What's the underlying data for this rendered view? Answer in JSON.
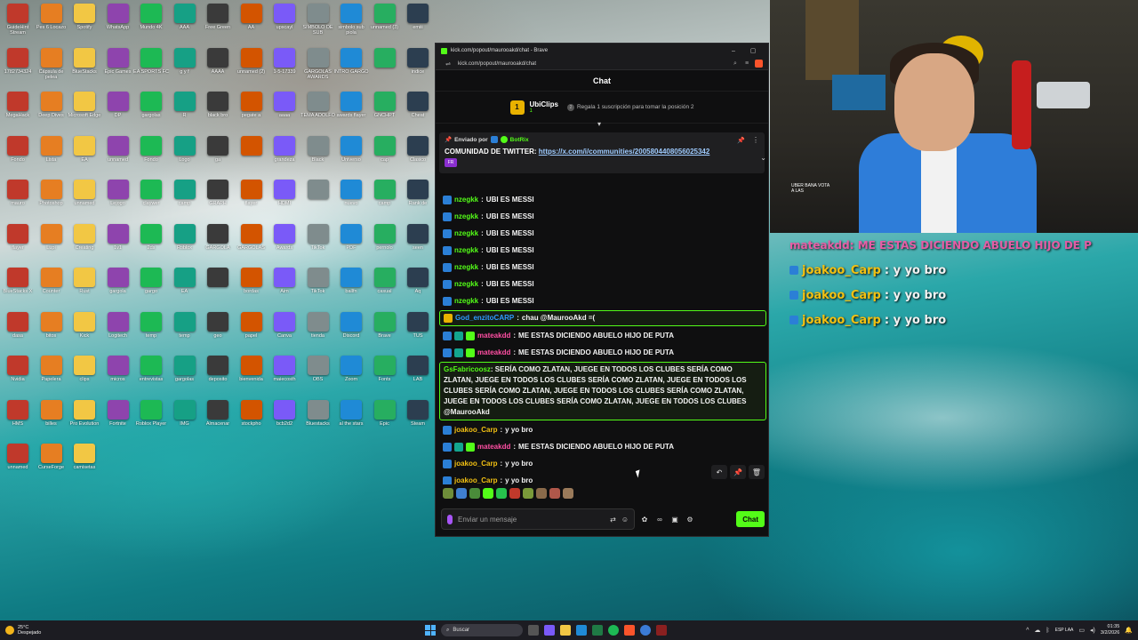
{
  "browser": {
    "title": "kick.com/popout/maurooakd/chat - Brave",
    "url": "kick.com/popout/maurooakd/chat",
    "minimize": "–",
    "maximize": "▢"
  },
  "chat": {
    "header": "Chat",
    "leaderboard": {
      "rank": "1",
      "top_user": "UbiClips",
      "top_count": "1",
      "gift_hint": "Regala 1 suscripción para tomar la posición 2"
    },
    "pinned": {
      "sent_by": "Enviado por",
      "bot_name": "BotRix",
      "prefix": "COMUNIDAD DE TWITTER:",
      "link": "https://x.com/i/communities/2005804408056025342",
      "emote_label": "FR"
    },
    "messages": [
      {
        "user": "nzegkk",
        "text": "UBI ES MESSI",
        "color": "#53fc18"
      },
      {
        "user": "nzegkk",
        "text": "UBI ES MESSI",
        "color": "#53fc18"
      },
      {
        "user": "nzegkk",
        "text": "UBI ES MESSI",
        "color": "#53fc18"
      },
      {
        "user": "nzegkk",
        "text": "UBI ES MESSI",
        "color": "#53fc18"
      },
      {
        "user": "nzegkk",
        "text": "UBI ES MESSI",
        "color": "#53fc18"
      },
      {
        "user": "nzegkk",
        "text": "UBI ES MESSI",
        "color": "#53fc18"
      },
      {
        "user": "nzegkk",
        "text": "UBI ES MESSI",
        "color": "#53fc18"
      }
    ],
    "highlight1": {
      "user": "God_enzitoCARP",
      "text": "chau @MaurooAkd =(",
      "color": "#2f9bff"
    },
    "mateakdd1": {
      "user": "mateakdd",
      "text": "ME ESTAS DICIENDO ABUELO HIJO DE PUTA",
      "color": "#ff4fa3"
    },
    "mateakdd2": {
      "user": "mateakdd",
      "text": "ME ESTAS DICIENDO ABUELO HIJO DE PUTA",
      "color": "#ff4fa3"
    },
    "highlight2": {
      "user": "GsFabricoosz",
      "text": "SERÍA COMO ZLATAN, JUEGE EN TODOS LOS CLUBES SERÍA COMO ZLATAN, JUEGE EN TODOS LOS CLUBES SERÍA COMO ZLATAN, JUEGE EN TODOS LOS CLUBES SERÍA COMO ZLATAN, JUEGE EN TODOS LOS CLUBES SERÍA COMO ZLATAN, JUEGE EN TODOS LOS CLUBES SERÍA COMO ZLATAN, JUEGE EN TODOS LOS CLUBES @MaurooAkd",
      "color": "#53fc18"
    },
    "joakoo1": {
      "user": "joakoo_Carp",
      "text": "y yo bro",
      "color": "#f2c012"
    },
    "mateakdd3": {
      "user": "mateakdd",
      "text": "ME ESTAS DICIENDO ABUELO HIJO DE PUTA",
      "color": "#ff4fa3"
    },
    "joakoo2": {
      "user": "joakoo_Carp",
      "text": "y yo bro",
      "color": "#f2c012"
    },
    "joakoo3": {
      "user": "joakoo_Carp",
      "text": "y yo bro",
      "color": "#f2c012"
    },
    "composer": {
      "placeholder": "Enviar un mensaje",
      "send_label": "Chat"
    }
  },
  "stream_overlay": {
    "partial_line": "mateakdd: ME ESTAS DICIENDO ABUELO HIJO DE P",
    "lines": [
      {
        "user": "joakoo_Carp",
        "text": ": y yo bro"
      },
      {
        "user": "joakoo_Carp",
        "text": ": y yo bro"
      },
      {
        "user": "joakoo_Carp",
        "text": ": y yo bro"
      }
    ],
    "mini_text": "UBER BANA VOTA A LAS"
  },
  "desktop_icons": [
    "GuideHint Stream",
    "Pes 6 Locazo",
    "Spotify",
    "WhatsApp",
    "Mundo 4K",
    "AAA",
    "Free Green",
    "AA",
    "upscayl",
    "SIMBOLO DE SUB",
    "simbolo sub piola",
    "unnamed (3)",
    "emiii",
    "1782734324",
    "Cápsula de pelea",
    "BlueStacks",
    "Epic Games",
    "EA SPORTS FC",
    "g y f",
    "AAAA",
    "unnamed (2)",
    "1-5-17339",
    "GARGOLAS AWARDS",
    "INTRO GARGO",
    "",
    "indice",
    "MegaHack",
    "Deep Dives",
    "Microsoft Edge",
    "DP",
    "gargolas",
    "R",
    "black bro",
    "pegate a",
    "aaaa",
    "TEMA ADOLFO",
    "awards flayer",
    "GNCHPT",
    "Cheat",
    "Fondo",
    "Lista",
    "EA",
    "unnamed",
    "Fondo",
    "Logo",
    "ga",
    "",
    "grandeza",
    "Black",
    "Universo",
    "cap",
    "Clasico",
    "mauro",
    "Photoshop",
    "unnamed",
    "Lejogo",
    "claywer",
    "camp",
    "GRAPH",
    "flayer",
    "HDMI",
    "",
    "nuevo",
    "camp",
    "Rank de",
    "flayer",
    "Lupi",
    "Creating",
    "1v1",
    "2ds",
    "Roblox",
    "GARGOLA",
    "GARGOLAS",
    "Awards",
    "TikTok",
    "PDF",
    "pernolo",
    "seen",
    "BlueStacks X",
    "Counter",
    "Rust",
    "gargola",
    "gargo",
    "EA",
    "",
    "bordas",
    "Aim",
    "TikTok",
    "ballfn",
    "casual",
    "Aq",
    "dasa",
    "bitos",
    "Kick",
    "Logitech",
    "temp",
    "temp",
    "geo",
    "papel",
    "Canva",
    "tienda",
    "Discord",
    "Brave",
    "TUS",
    "Nvidia",
    "Papelera",
    "clips",
    "micros",
    "entrevistas",
    "gargolas",
    "deposito",
    "bienvenida",
    "maiecosth",
    "OBS",
    "Zoom",
    "Fonts",
    "LAB",
    "HMS",
    "billes",
    "Pro Evolution",
    "Fortnite",
    "Roblox Player",
    "IMG",
    "Almacenar",
    "stockpho",
    "bcb2d2",
    "Bluestacks",
    "al the stars",
    "Epic",
    "Steam",
    "unnamed",
    "CurseForge",
    "camisetas"
  ],
  "taskbar": {
    "weather_temp": "25°C",
    "weather_desc": "Despejado",
    "search": "Buscar",
    "lang": "ESP LAA",
    "time": "01:35",
    "date": "3/2/2026"
  },
  "colors": {
    "kick_green": "#53fc18",
    "window_bg": "#0f0f10",
    "overlay_username": "#f2c012"
  }
}
